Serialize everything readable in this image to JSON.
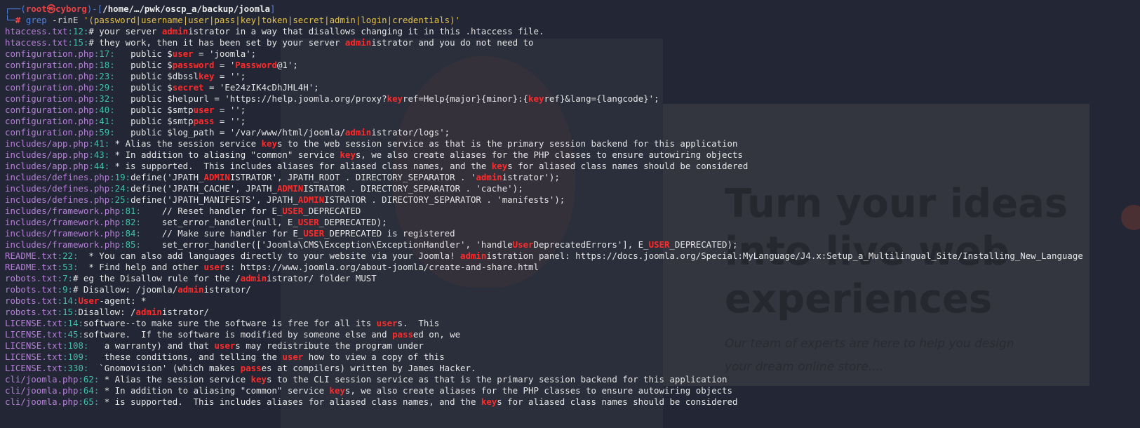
{
  "prompt": {
    "user": "root",
    "skull": "㉿",
    "host": "cyborg",
    "path": "/home/…/pwk/oscp_a/backup/joomla",
    "command_word": "grep",
    "command_flags": "-rinE",
    "command_pattern": "'(password|username|user|pass|key|token|secret|admin|login|credentials)'"
  },
  "background": {
    "headline": "Turn your ideas into live web experiences",
    "tagline": "Our team of experts are here to help you design your dream online store...."
  },
  "results": [
    {
      "file": "htaccess.txt",
      "line": "12",
      "text": "# your server [[admin]]istrator in a way that disallows changing it in this .htaccess file."
    },
    {
      "file": "htaccess.txt",
      "line": "15",
      "text": "# they work, then it has been set by your server [[admin]]istrator and you do not need to"
    },
    {
      "file": "configuration.php",
      "line": "17",
      "text": "   public $[[user]] = 'joomla';"
    },
    {
      "file": "configuration.php",
      "line": "18",
      "text": "   public $[[password]] = '[[Password]]@1';"
    },
    {
      "file": "configuration.php",
      "line": "23",
      "text": "   public $dbssl[[key]] = '';"
    },
    {
      "file": "configuration.php",
      "line": "29",
      "text": "   public $[[secret]] = 'Ee24zIK4cDhJHL4H';"
    },
    {
      "file": "configuration.php",
      "line": "32",
      "text": "   public $helpurl = 'https://help.joomla.org/proxy?[[key]]ref=Help{major}{minor}:{[[key]]ref}&lang={langcode}';"
    },
    {
      "file": "configuration.php",
      "line": "40",
      "text": "   public $smtp[[user]] = '';"
    },
    {
      "file": "configuration.php",
      "line": "41",
      "text": "   public $smtp[[pass]] = '';"
    },
    {
      "file": "configuration.php",
      "line": "59",
      "text": "   public $log_path = '/var/www/html/joomla/[[admin]]istrator/logs';"
    },
    {
      "file": "includes/app.php",
      "line": "41",
      "text": " * Alias the session service [[key]]s to the web session service as that is the primary session backend for this application"
    },
    {
      "file": "includes/app.php",
      "line": "43",
      "text": " * In addition to aliasing \"common\" service [[key]]s, we also create aliases for the PHP classes to ensure autowiring objects"
    },
    {
      "file": "includes/app.php",
      "line": "44",
      "text": " * is supported.  This includes aliases for aliased class names, and the [[key]]s for aliased class names should be considered"
    },
    {
      "file": "includes/defines.php",
      "line": "19",
      "text": "define('JPATH_[[ADMIN]]ISTRATOR', JPATH_ROOT . DIRECTORY_SEPARATOR . '[[admin]]istrator');"
    },
    {
      "file": "includes/defines.php",
      "line": "24",
      "text": "define('JPATH_CACHE', JPATH_[[ADMIN]]ISTRATOR . DIRECTORY_SEPARATOR . 'cache');"
    },
    {
      "file": "includes/defines.php",
      "line": "25",
      "text": "define('JPATH_MANIFESTS', JPATH_[[ADMIN]]ISTRATOR . DIRECTORY_SEPARATOR . 'manifests');"
    },
    {
      "file": "includes/framework.php",
      "line": "81",
      "text": "    // Reset handler for E_[[USER]]_DEPRECATED"
    },
    {
      "file": "includes/framework.php",
      "line": "82",
      "text": "    set_error_handler(null, E_[[USER]]_DEPRECATED);"
    },
    {
      "file": "includes/framework.php",
      "line": "84",
      "text": "    // Make sure handler for E_[[USER]]_DEPRECATED is registered"
    },
    {
      "file": "includes/framework.php",
      "line": "85",
      "text": "    set_error_handler(['Joomla\\CMS\\Exception\\ExceptionHandler', 'handle[[User]]DeprecatedErrors'], E_[[USER]]_DEPRECATED);"
    },
    {
      "file": "README.txt",
      "line": "22",
      "text": "  * You can also add languages directly to your website via your Joomla! [[admin]]istration panel: https://docs.joomla.org/Special:MyLanguage/J4.x:Setup_a_Multilingual_Site/Installing_New_Language",
      "wrap": true
    },
    {
      "file": "README.txt",
      "line": "53",
      "text": "  * Find help and other [[user]]s: https://www.joomla.org/about-joomla/create-and-share.html"
    },
    {
      "file": "robots.txt",
      "line": "7",
      "text": "# eg the Disallow rule for the /[[admin]]istrator/ folder MUST"
    },
    {
      "file": "robots.txt",
      "line": "9",
      "text": "# Disallow: /joomla/[[admin]]istrator/"
    },
    {
      "file": "robots.txt",
      "line": "14",
      "text": "[[User]]-agent: *"
    },
    {
      "file": "robots.txt",
      "line": "15",
      "text": "Disallow: /[[admin]]istrator/"
    },
    {
      "file": "LICENSE.txt",
      "line": "14",
      "text": "software--to make sure the software is free for all its [[user]]s.  This"
    },
    {
      "file": "LICENSE.txt",
      "line": "45",
      "text": "software.  If the software is modified by someone else and [[pass]]ed on, we"
    },
    {
      "file": "LICENSE.txt",
      "line": "108",
      "text": "   a warranty) and that [[user]]s may redistribute the program under"
    },
    {
      "file": "LICENSE.txt",
      "line": "109",
      "text": "   these conditions, and telling the [[user]] how to view a copy of this"
    },
    {
      "file": "LICENSE.txt",
      "line": "330",
      "text": "  `Gnomovision' (which makes [[pass]]es at compilers) written by James Hacker."
    },
    {
      "file": "cli/joomla.php",
      "line": "62",
      "text": " * Alias the session service [[key]]s to the CLI session service as that is the primary session backend for this application"
    },
    {
      "file": "cli/joomla.php",
      "line": "64",
      "text": " * In addition to aliasing \"common\" service [[key]]s, we also create aliases for the PHP classes to ensure autowiring objects"
    },
    {
      "file": "cli/joomla.php",
      "line": "65",
      "text": " * is supported.  This includes aliases for aliased class names, and the [[key]]s for aliased class names should be considered"
    }
  ]
}
